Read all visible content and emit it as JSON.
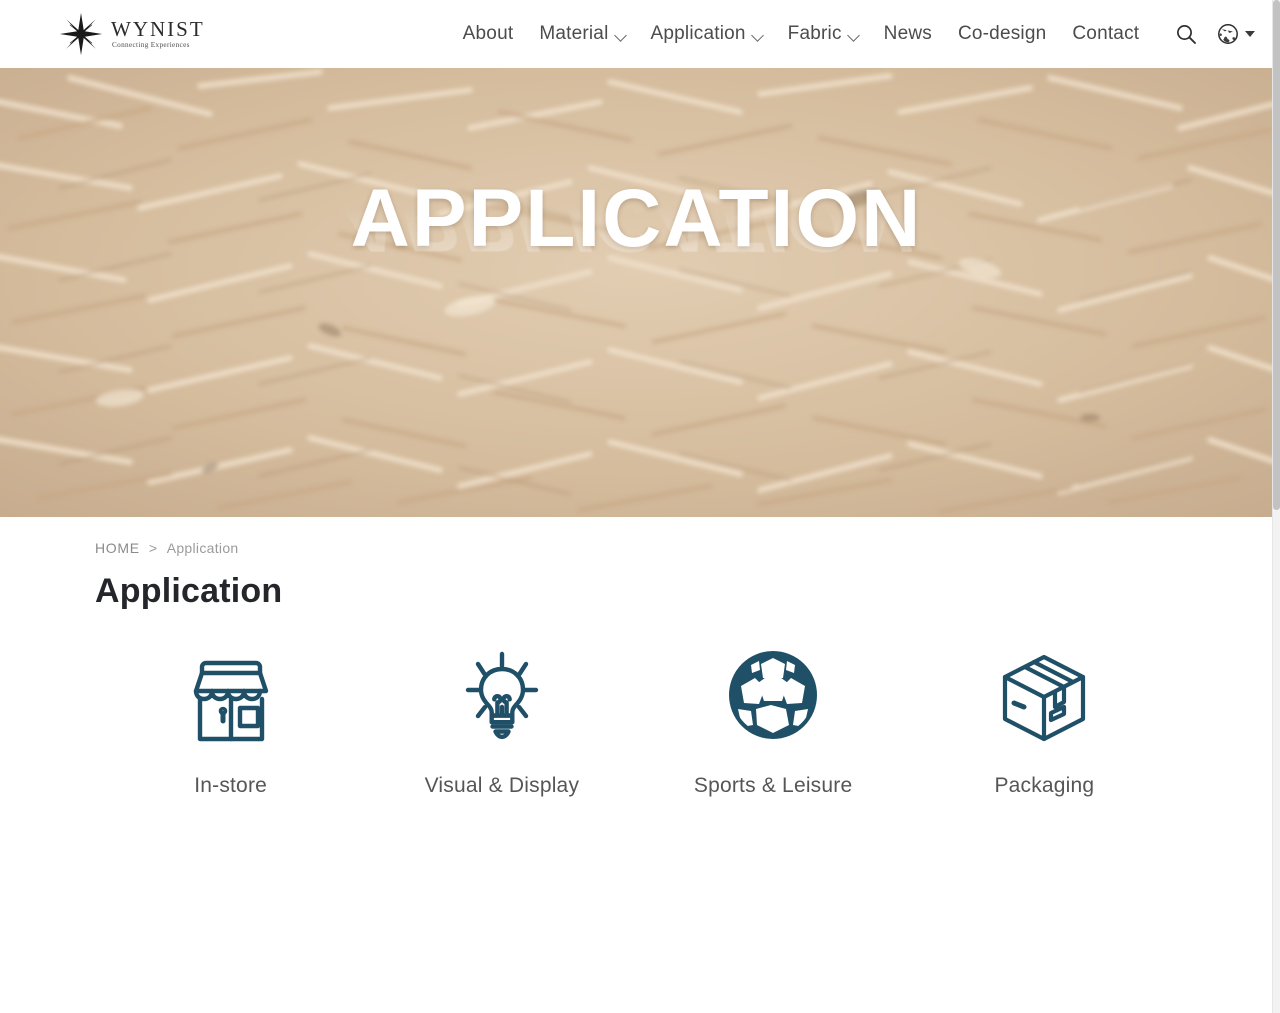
{
  "site": {
    "logo_name": "WYNIST",
    "logo_tagline": "Connecting Experiences",
    "logo_icon": "compass-star-icon"
  },
  "header": {
    "nav": [
      {
        "label": "About",
        "has_dropdown": false
      },
      {
        "label": "Material",
        "has_dropdown": true
      },
      {
        "label": "Application",
        "has_dropdown": true
      },
      {
        "label": "Fabric",
        "has_dropdown": true
      },
      {
        "label": "News",
        "has_dropdown": false
      },
      {
        "label": "Co-design",
        "has_dropdown": false
      },
      {
        "label": "Contact",
        "has_dropdown": false
      }
    ],
    "search_icon": "search-icon",
    "language_icon": "globe-icon",
    "language_caret": "chevron-down-icon"
  },
  "hero": {
    "title": "APPLICATION",
    "reflection": "APPLICATION",
    "background": "wood-shavings-texture"
  },
  "breadcrumb": {
    "home": "HOME",
    "separator": ">",
    "current": "Application"
  },
  "page": {
    "title": "Application"
  },
  "cards": [
    {
      "label": "In-store",
      "icon": "storefront-icon"
    },
    {
      "label": "Visual & Display",
      "icon": "lightbulb-icon"
    },
    {
      "label": "Sports & Leisure",
      "icon": "soccer-ball-icon"
    },
    {
      "label": "Packaging",
      "icon": "box-icon"
    }
  ],
  "colors": {
    "icon_teal": "#1f5068",
    "nav_text": "#4c4c4c",
    "title_text": "#24262b",
    "breadcrumb_text": "#8b8b8b",
    "hero_sand": "#cdb49a"
  }
}
